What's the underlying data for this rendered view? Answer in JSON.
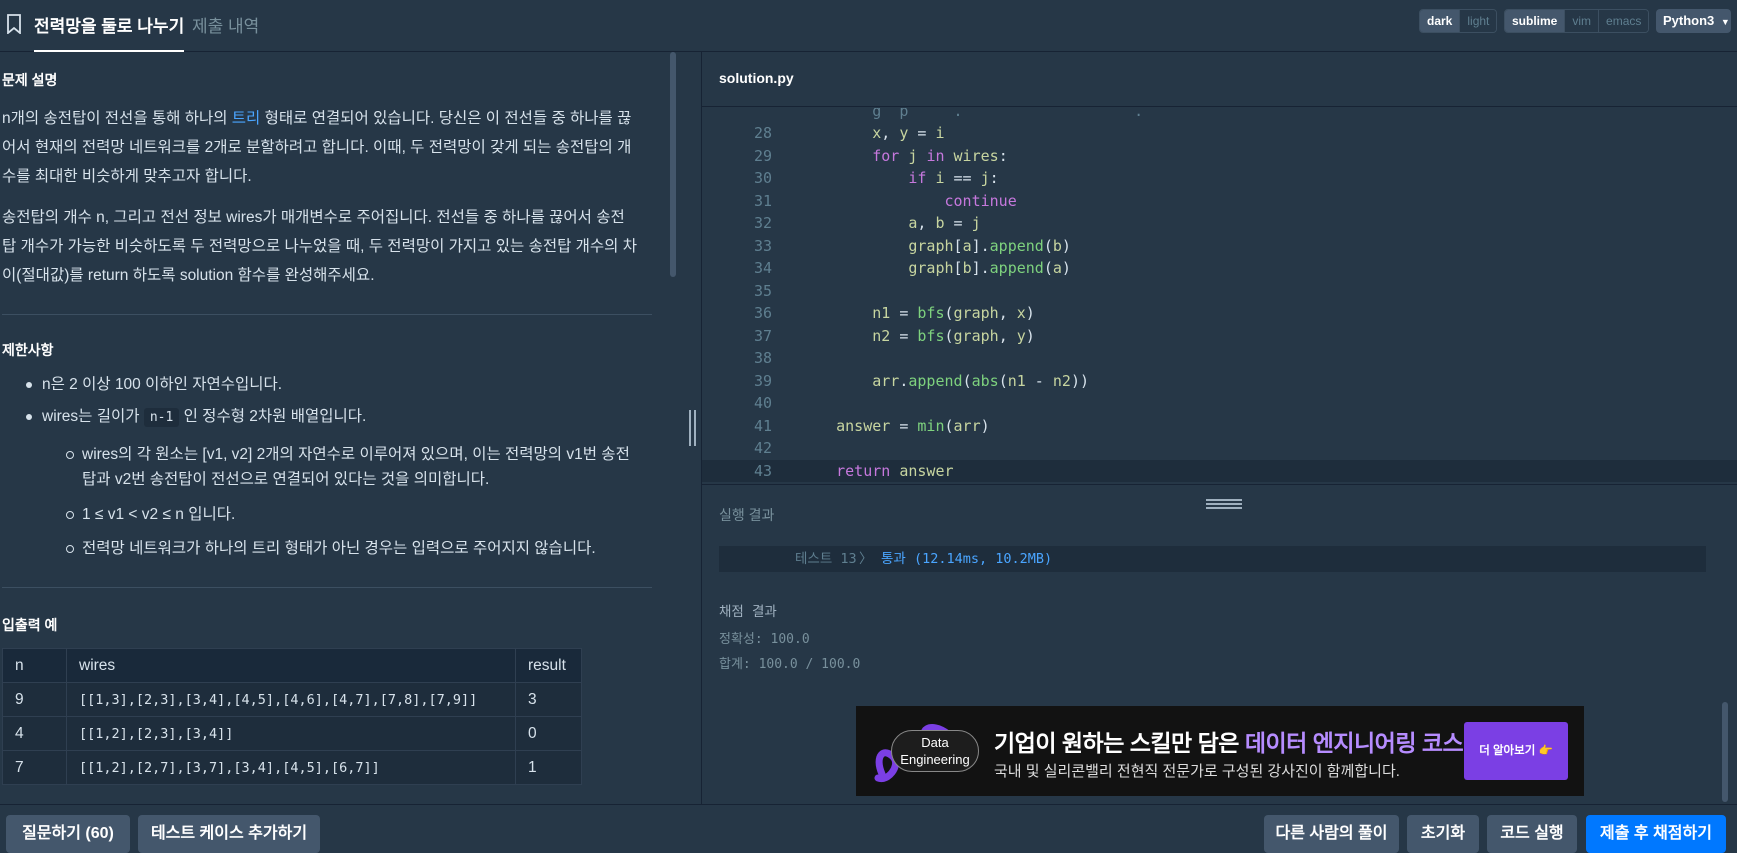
{
  "header": {
    "tab_problem": "전력망을 둘로 나누기",
    "tab_submissions": "제출 내역",
    "theme_options": [
      "dark",
      "light"
    ],
    "keymap_options": [
      "sublime",
      "vim",
      "emacs"
    ],
    "language": "Python3"
  },
  "problem": {
    "desc_title": "문제 설명",
    "desc_p1_pre": "n개의 송전탑이 전선을 통해 하나의 ",
    "desc_p1_link": "트리",
    "desc_p1_l1_post": " 형태로 연결되어 있습니다. 당신은 이 전선들 중 하나를 끊",
    "desc_p1_l2": "어서 현재의 전력망 네트워크를 2개로 분할하려고 합니다. 이때, 두 전력망이 갖게 되는 송전탑의 개",
    "desc_p1_l3": "수를 최대한 비슷하게 맞추고자 합니다.",
    "desc_p2_l1": "송전탑의 개수 n, 그리고 전선 정보 wires가 매개변수로 주어집니다. 전선들 중 하나를 끊어서 송전",
    "desc_p2_l2": "탑 개수가 가능한 비슷하도록 두 전력망으로 나누었을 때, 두 전력망이 가지고 있는 송전탑 개수의 차",
    "desc_p2_l3": "이(절대값)를 return 하도록 solution 함수를 완성해주세요.",
    "constraints_title": "제한사항",
    "c1": "n은 2 이상 100 이하인 자연수입니다.",
    "c2_pre": "wires는 길이가 ",
    "c2_code": "n-1",
    "c2_post": " 인 정수형 2차원 배열입니다.",
    "c2a_l1": "wires의 각 원소는 [v1, v2] 2개의 자연수로 이루어져 있으며, 이는 전력망의 v1번 송전",
    "c2a_l2": "탑과 v2번 송전탑이 전선으로 연결되어 있다는 것을 의미합니다.",
    "c2b": "1 ≤ v1 < v2 ≤ n 입니다.",
    "c2c": "전력망 네트워크가 하나의 트리 형태가 아닌 경우는 입력으로 주어지지 않습니다.",
    "io_title": "입출력 예",
    "io_headers": [
      "n",
      "wires",
      "result"
    ],
    "io_rows": [
      [
        "9",
        "[[1,3],[2,3],[3,4],[4,5],[4,6],[4,7],[7,8],[7,9]]",
        "3"
      ],
      [
        "4",
        "[[1,2],[2,3],[3,4]]",
        "0"
      ],
      [
        "7",
        "[[1,2],[2,7],[3,7],[3,4],[4,5],[6,7]]",
        "1"
      ]
    ]
  },
  "editor": {
    "filename": "solution.py",
    "line_numbers": [
      "28",
      "29",
      "30",
      "31",
      "32",
      "33",
      "34",
      "35",
      "36",
      "37",
      "38",
      "39",
      "40",
      "41",
      "42",
      "43"
    ]
  },
  "results": {
    "run_label": "실행 결과",
    "test_name": "테스트 13",
    "test_sep": "〉",
    "test_status": "통과 (12.14ms, 10.2MB)",
    "grading_label": "채점 결과",
    "accuracy": "정확성: 100.0",
    "total": "합계: 100.0 / 100.0"
  },
  "ad": {
    "badge_l1": "Data",
    "badge_l2": "Engineering",
    "title_pre": "기업이 원하는 스킬만 담은 ",
    "title_hl": "데이터 엔지니어링 코스",
    "subtitle": "국내 및 실리콘밸리 전현직 전문가로 구성된 강사진이 함께합니다.",
    "cta": "더 알아보기 👉",
    "accent": "#7b3fe4"
  },
  "footer": {
    "ask": "질문하기 (60)",
    "add_testcase": "테스트 케이스 추가하기",
    "others": "다른 사람의 풀이",
    "reset": "초기화",
    "run": "코드 실행",
    "submit": "제출 후 채점하기"
  }
}
